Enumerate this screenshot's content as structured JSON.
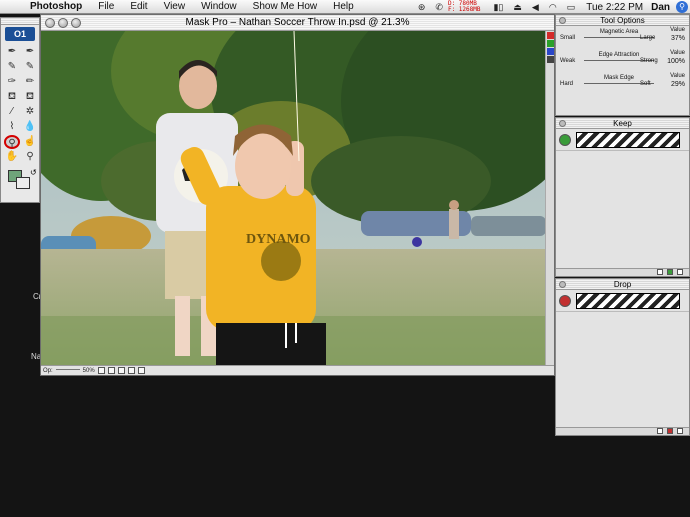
{
  "menubar": {
    "apple_icon": "apple-icon",
    "items": [
      "Photoshop",
      "File",
      "Edit",
      "View",
      "Window",
      "Show Me How",
      "Help"
    ],
    "memory_line1": "D: 780MB",
    "memory_line2": "F: 1268MB",
    "clock": "Tue 2:22 PM",
    "user": "Dan"
  },
  "document": {
    "title": "Mask Pro – Nathan Soccer Throw In.psd @ 21.3%",
    "status_op_label": "Op:",
    "status_zoom": "50%"
  },
  "tool_options": {
    "title": "Tool Options",
    "rows": [
      {
        "left": "Small",
        "middle": "Magnetic Area",
        "right": "Large",
        "value_label": "Value",
        "value": "37%"
      },
      {
        "left": "Weak",
        "middle": "Edge Attraction",
        "right": "Strong",
        "value_label": "Value",
        "value": "100%"
      },
      {
        "left": "Hard",
        "middle": "Mask Edge",
        "right": "Soft",
        "value_label": "Value",
        "value": "29%"
      }
    ]
  },
  "keep_panel": {
    "title": "Keep"
  },
  "drop_panel": {
    "title": "Drop"
  },
  "left_fragments": [
    "Cr",
    "Na"
  ],
  "colors": {
    "keep_eye": "#3a9c3a",
    "drop_eye": "#c23030",
    "selected_tool_ring": "#d40000"
  }
}
